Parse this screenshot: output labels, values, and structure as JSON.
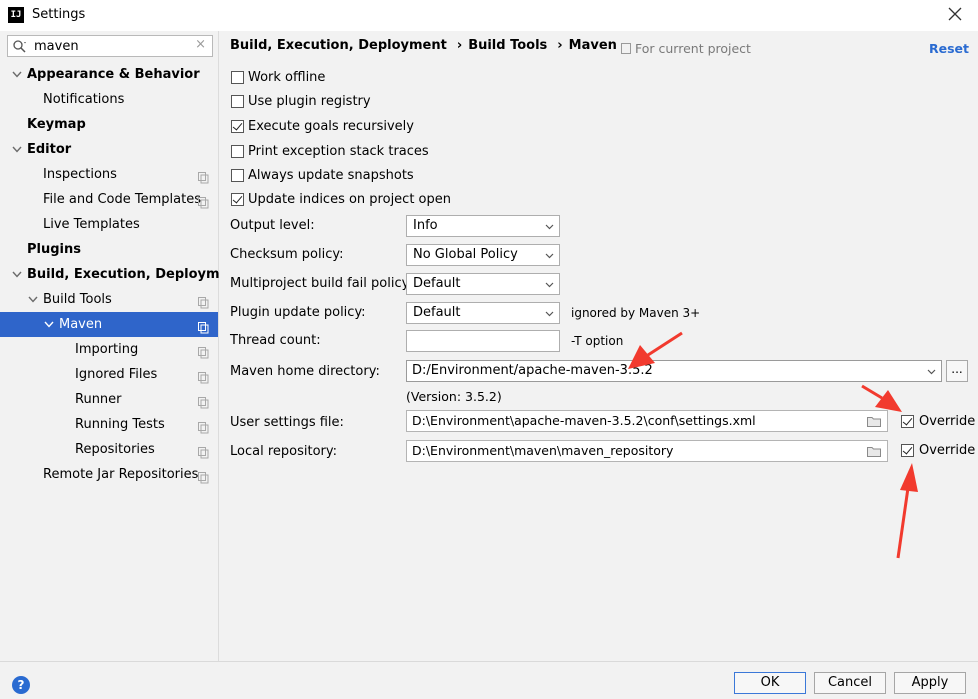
{
  "window": {
    "title": "Settings",
    "app_icon_text": "IJ"
  },
  "search": {
    "value": "maven",
    "clear_glyph": "×"
  },
  "tree": [
    {
      "label": "Appearance & Behavior",
      "bold": true,
      "expanded": true
    },
    {
      "label": "Notifications"
    },
    {
      "label": "Keymap",
      "bold": true
    },
    {
      "label": "Editor",
      "bold": true,
      "expanded": true
    },
    {
      "label": "Inspections",
      "project": true
    },
    {
      "label": "File and Code Templates",
      "project": true
    },
    {
      "label": "Live Templates"
    },
    {
      "label": "Plugins",
      "bold": true
    },
    {
      "label": "Build, Execution, Deployment",
      "bold": true,
      "expanded": true
    },
    {
      "label": "Build Tools",
      "project": true,
      "expanded": true
    },
    {
      "label": "Maven",
      "project": true,
      "expanded": true,
      "selected": true
    },
    {
      "label": "Importing",
      "project": true
    },
    {
      "label": "Ignored Files",
      "project": true
    },
    {
      "label": "Runner",
      "project": true
    },
    {
      "label": "Running Tests",
      "project": true
    },
    {
      "label": "Repositories",
      "project": true
    },
    {
      "label": "Remote Jar Repositories",
      "project": true
    }
  ],
  "breadcrumbs": [
    "Build, Execution, Deployment",
    "Build Tools",
    "Maven"
  ],
  "breadcrumb_sep": "›",
  "scope_label": "For current project",
  "reset_label": "Reset",
  "checkboxes": [
    {
      "label": "Work offline",
      "checked": false
    },
    {
      "label": "Use plugin registry",
      "checked": false
    },
    {
      "label": "Execute goals recursively",
      "checked": true
    },
    {
      "label": "Print exception stack traces",
      "checked": false
    },
    {
      "label": "Always update snapshots",
      "checked": false
    },
    {
      "label": "Update indices on project open",
      "checked": true
    }
  ],
  "form": {
    "output_level": {
      "label": "Output level:",
      "value": "Info"
    },
    "checksum_policy": {
      "label": "Checksum policy:",
      "value": "No Global Policy"
    },
    "multiproject_fail_policy": {
      "label": "Multiproject build fail policy:",
      "value": "Default"
    },
    "plugin_update_policy": {
      "label": "Plugin update policy:",
      "value": "Default",
      "hint": "ignored by Maven 3+"
    },
    "thread_count": {
      "label": "Thread count:",
      "value": "",
      "hint": "-T option"
    },
    "maven_home": {
      "label": "Maven home directory:",
      "value": "D:/Environment/apache-maven-3.5.2",
      "browse_label": "...",
      "version": "(Version: 3.5.2)"
    },
    "user_settings": {
      "label": "User settings file:",
      "value": "D:\\Environment\\apache-maven-3.5.2\\conf\\settings.xml",
      "override_label": "Override",
      "override_checked": true
    },
    "local_repo": {
      "label": "Local repository:",
      "value": "D:\\Environment\\maven\\maven_repository",
      "override_label": "Override",
      "override_checked": true
    }
  },
  "buttons": {
    "ok": "OK",
    "cancel": "Cancel",
    "apply": "Apply",
    "help": "?"
  },
  "colors": {
    "selection": "#2f65ca",
    "link": "#2a6bd1",
    "annotation": "#f23a2e"
  }
}
